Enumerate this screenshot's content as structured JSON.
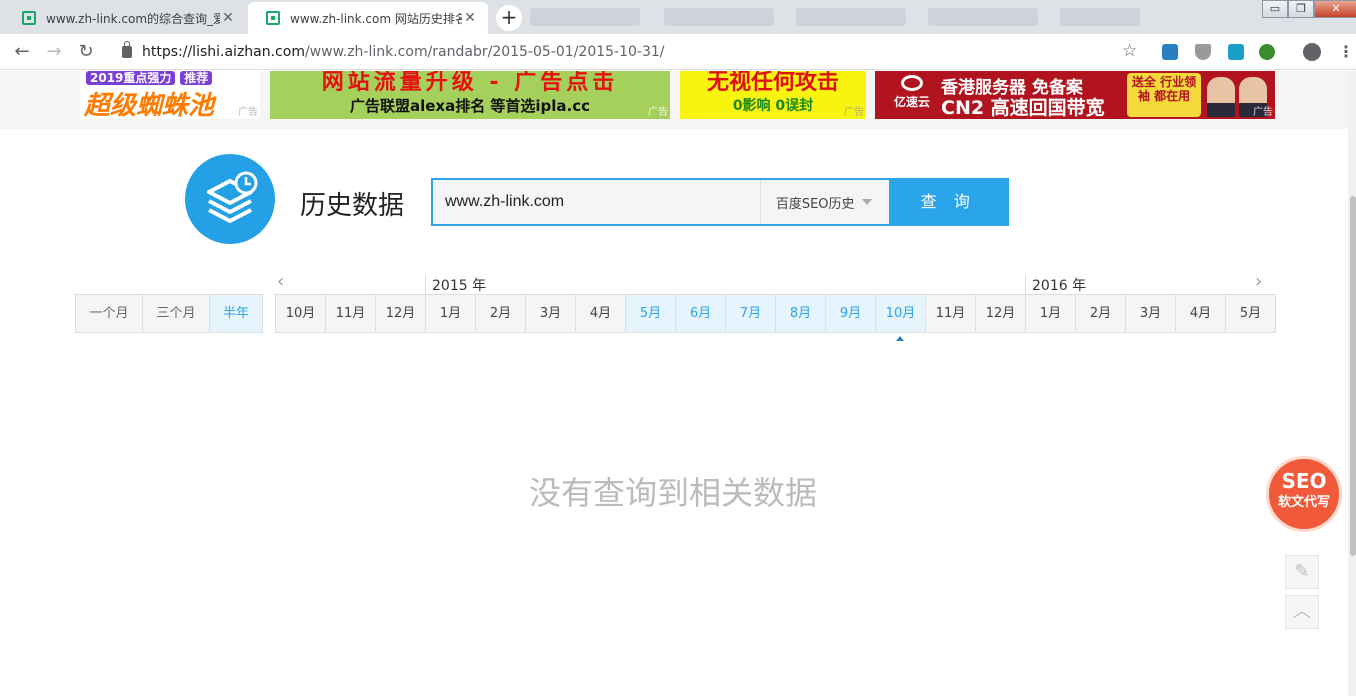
{
  "browser": {
    "tabs": [
      {
        "title": "www.zh-link.com的综合查询_爱站",
        "active": false
      },
      {
        "title": "www.zh-link.com 网站历史排名",
        "active": true
      }
    ],
    "new_tab": "+",
    "close_glyph": "✕",
    "url_host": "https://lishi.aizhan.com",
    "url_path": "/www.zh-link.com/randabr/2015-05-01/2015-10-31/",
    "window_controls": {
      "minimize": "▭",
      "restore": "❐",
      "close": "✕"
    }
  },
  "ads": [
    {
      "line1": "2019重点强力",
      "badge": "推荐",
      "line2": "超级蜘蛛池",
      "tag": "广告"
    },
    {
      "line1": "网站流量升级 - 广告点击",
      "line2": "广告联盟alexa排名 等首选ipla.cc",
      "tag": "广告"
    },
    {
      "line1": "无视任何攻击",
      "line2": "0影响 0误封",
      "tag": "广告"
    },
    {
      "logo": "亿速云",
      "line1": "香港服务器 免备案",
      "line2": "CN2 高速回国带宽",
      "badge": "送全 行业领袖 都在用",
      "tag": "广告"
    }
  ],
  "page": {
    "title": "历史数据",
    "search_value": "www.zh-link.com",
    "select_value": "百度SEO历史",
    "search_button": "查 询",
    "years": [
      "2015 年",
      "2016 年"
    ],
    "range_buttons": [
      {
        "label": "一个月",
        "active": false
      },
      {
        "label": "三个月",
        "active": false
      },
      {
        "label": "半年",
        "active": true
      }
    ],
    "months": [
      {
        "label": "10月",
        "active": false
      },
      {
        "label": "11月",
        "active": false
      },
      {
        "label": "12月",
        "active": false
      },
      {
        "label": "1月",
        "active": false
      },
      {
        "label": "2月",
        "active": false
      },
      {
        "label": "3月",
        "active": false
      },
      {
        "label": "4月",
        "active": false
      },
      {
        "label": "5月",
        "active": true
      },
      {
        "label": "6月",
        "active": true
      },
      {
        "label": "7月",
        "active": true
      },
      {
        "label": "8月",
        "active": true
      },
      {
        "label": "9月",
        "active": true
      },
      {
        "label": "10月",
        "active": true
      },
      {
        "label": "11月",
        "active": false
      },
      {
        "label": "12月",
        "active": false
      },
      {
        "label": "1月",
        "active": false
      },
      {
        "label": "2月",
        "active": false
      },
      {
        "label": "3月",
        "active": false
      },
      {
        "label": "4月",
        "active": false
      },
      {
        "label": "5月",
        "active": false
      }
    ],
    "empty_message": "没有查询到相关数据",
    "float_badge": {
      "line1": "SEO",
      "line2": "软文代写"
    },
    "icons": {
      "edit": "pencil-icon",
      "top": "chevron-up-icon"
    }
  },
  "colors": {
    "accent": "#2aa4ea",
    "logo_bg": "#24a0e6",
    "active_month_bg": "#e6f4fd"
  }
}
